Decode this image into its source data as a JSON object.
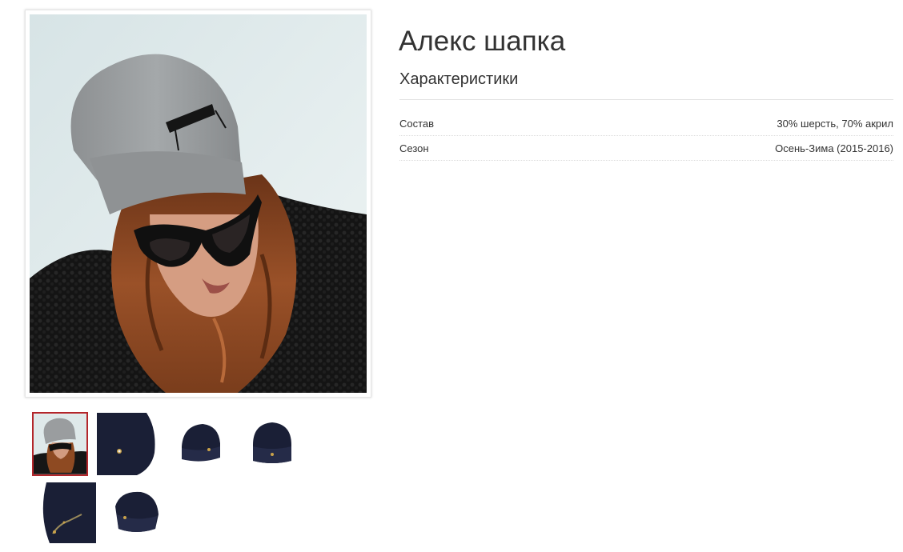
{
  "product": {
    "title": "Алекс шапка",
    "specs_heading": "Характеристики",
    "specs": [
      {
        "name": "Состав",
        "value": "30% шерсть, 70% акрил"
      },
      {
        "name": "Сезон",
        "value": "Осень-Зима (2015-2016)"
      }
    ]
  },
  "gallery": {
    "main_image": "woman-grey-beanie-photo",
    "thumbnails": [
      {
        "name": "woman-grey-beanie-thumb",
        "active": true
      },
      {
        "name": "navy-beanie-closeup-thumb",
        "active": false
      },
      {
        "name": "navy-beanie-side-thumb",
        "active": false
      },
      {
        "name": "navy-beanie-front-thumb",
        "active": false
      },
      {
        "name": "navy-beanie-detail-thumb",
        "active": false
      },
      {
        "name": "navy-beanie-angle-thumb",
        "active": false
      }
    ]
  },
  "colors": {
    "text": "#333333",
    "active_thumb_border": "#b3262b",
    "divider": "#e2e2e2"
  }
}
